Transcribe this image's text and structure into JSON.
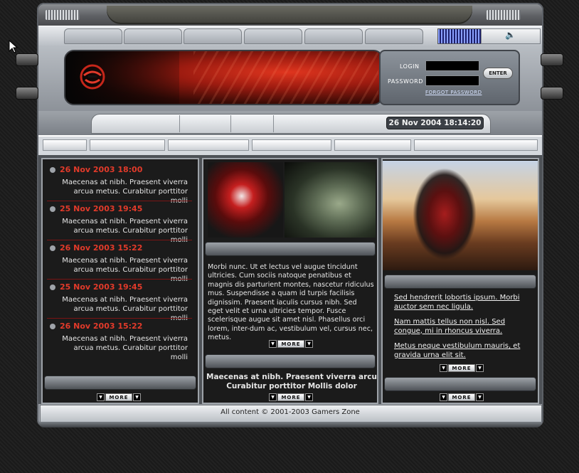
{
  "header": {
    "login_label": "LOGIN",
    "password_label": "PASSWORD",
    "enter_label": "ENTER",
    "forgot_password": "FORGOT PASSWORD"
  },
  "subnav": {
    "datetime": "26 Nov 2004 18:14:20"
  },
  "news": {
    "items": [
      {
        "date": "26 Nov 2003 18:00",
        "text": "Maecenas at nibh. Praesent viverra arcua metus. Curabitur porttitor molli"
      },
      {
        "date": "25 Nov 2003 19:45",
        "text": "Maecenas at nibh. Praesent viverra arcua metus. Curabitur porttitor molli"
      },
      {
        "date": "26 Nov 2003 15:22",
        "text": "Maecenas at nibh. Praesent viverra arcua metus. Curabitur porttitor molli"
      },
      {
        "date": "25 Nov 2003 19:45",
        "text": "Maecenas at nibh. Praesent viverra arcua metus. Curabitur porttitor molli"
      },
      {
        "date": "26 Nov 2003 15:22",
        "text": "Maecenas at nibh. Praesent viverra arcua metus. Curabitur porttitor molli"
      }
    ]
  },
  "middle": {
    "paragraph": "Morbi nunc. Ut et lectus vel augue tincidunt ultricies. Cum sociis natoque penatibus et magnis dis parturient montes, nascetur ridiculus mus. Suspendisse a quam id turpis facilisis dignissim. Praesent iaculis cursus nibh. Sed eget velit et urna ultricies tempor. Fusce scelerisque augue sit amet nisl. Phasellus orci lorem, inter-dum ac, vestibulum vel, cursus nec, metus.",
    "bold_text": "Maecenas at nibh. Praesent viverra arcu Curabitur porttitor Mollis dolor"
  },
  "right": {
    "links": [
      "Sed hendrerit lobortis ipsum. Morbi auctor sem nec ligula.",
      "Nam mattis tellus non nisl. Sed congue, mi in rhoncus viverra.",
      "Metus neque vestibulum mauris, et gravida urna elit sit."
    ]
  },
  "more_label": "MORE",
  "footer": {
    "text": "All content © 2001-2003 Gamers Zone"
  },
  "colors": {
    "accent_red": "#e23a2a",
    "panel_dark": "#1b1b1b",
    "metal": "#9da2a8"
  }
}
